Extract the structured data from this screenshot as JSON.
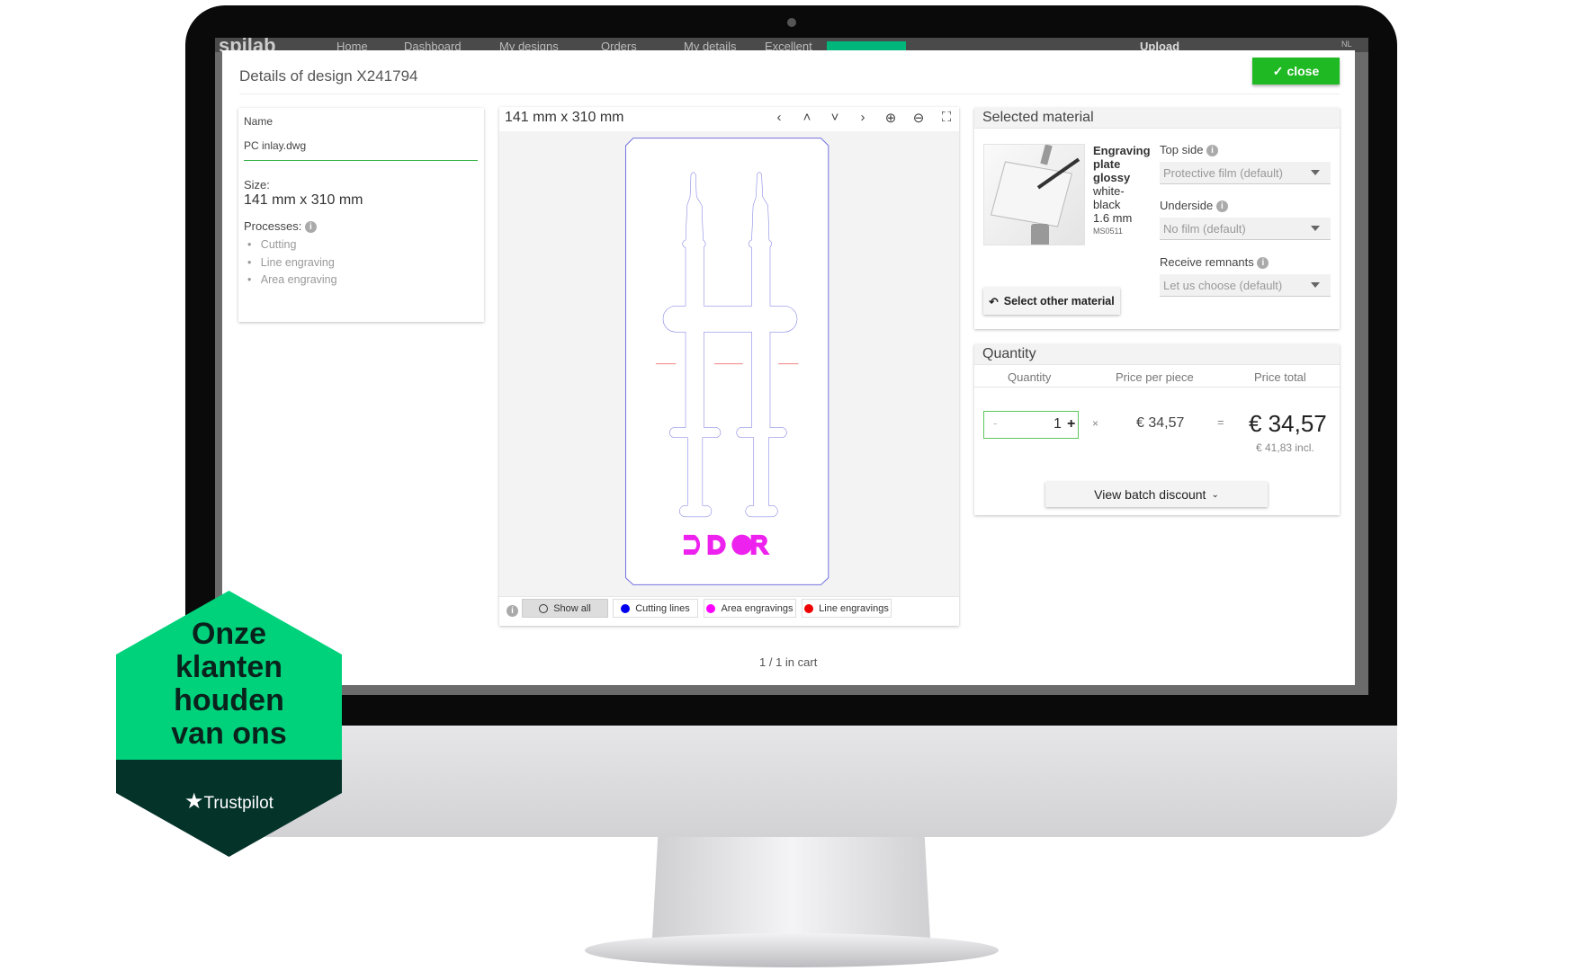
{
  "nav": {
    "logo": "spilab",
    "items": [
      "Home",
      "Dashboard",
      "My designs",
      "Orders",
      "My details"
    ],
    "rating": "Excellent",
    "upload": "Upload",
    "lang": "NL"
  },
  "modal": {
    "title": "Details of design X241794",
    "close_label": "close"
  },
  "details": {
    "name_label": "Name",
    "name_value": "PC inlay.dwg",
    "size_label": "Size:",
    "size_value": "141 mm x 310 mm",
    "processes_label": "Processes:",
    "processes": [
      "Cutting",
      "Line engraving",
      "Area engraving"
    ]
  },
  "viewer": {
    "dimensions": "141 mm x 310 mm",
    "icons": [
      "chevron-left",
      "chevron-up",
      "chevron-down",
      "chevron-right",
      "zoom-in",
      "zoom-out",
      "fullscreen"
    ],
    "logo_text": "DDOR",
    "legend": [
      {
        "label": "Show all",
        "color": ""
      },
      {
        "label": "Cutting lines",
        "color": "#0000ee"
      },
      {
        "label": "Area engravings",
        "color": "#ff00ff"
      },
      {
        "label": "Line engravings",
        "color": "#ee0000"
      }
    ]
  },
  "material": {
    "header": "Selected material",
    "name": "Engraving plate glossy",
    "color": "white-black",
    "thickness": "1.6 mm",
    "code": "MS0511",
    "top_side_label": "Top side",
    "top_side_value": "Protective film (default)",
    "underside_label": "Underside",
    "underside_value": "No film (default)",
    "remnants_label": "Receive remnants",
    "remnants_value": "Let us choose (default)",
    "select_other": "Select other material"
  },
  "quantity": {
    "header": "Quantity",
    "col_quantity": "Quantity",
    "col_price_piece": "Price per piece",
    "col_price_total": "Price total",
    "minus": "-",
    "value": "1",
    "plus": "+",
    "times": "×",
    "price_piece": "€ 34,57",
    "equals": "=",
    "price_total": "€ 34,57",
    "price_incl": "€ 41,83 incl.",
    "batch_discount": "View batch discount"
  },
  "cart_status": "1 / 1 in cart",
  "badge": {
    "lines": [
      "Onze",
      "klanten",
      "houden",
      "van ons"
    ],
    "brand": "Trustpilot"
  },
  "colors": {
    "accent": "#1fb923",
    "cutting": "#0000ee",
    "area": "#ff00ff",
    "line": "#ee0000",
    "badge_green": "#00d27c",
    "badge_dark": "#04332a"
  }
}
